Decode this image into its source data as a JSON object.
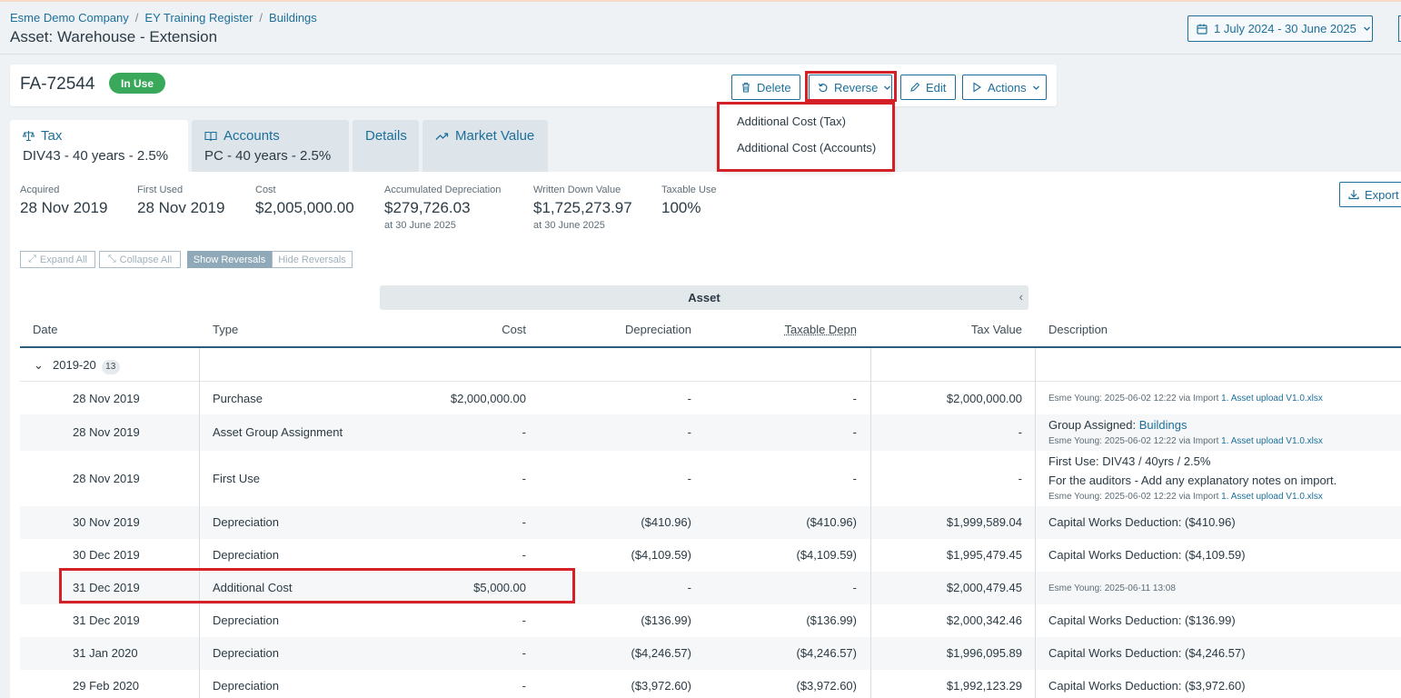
{
  "breadcrumb": [
    "Esme Demo Company",
    "EY Training Register",
    "Buildings"
  ],
  "page_title": "Asset: Warehouse - Extension",
  "date_range": "1 July 2024 - 30 June 2025",
  "asset": {
    "id": "FA-72544",
    "status": "In Use"
  },
  "toolbar": {
    "delete": "Delete",
    "reverse": "Reverse",
    "edit": "Edit",
    "actions": "Actions"
  },
  "reverse_menu": [
    "Additional Cost (Tax)",
    "Additional Cost (Accounts)"
  ],
  "tabs": [
    {
      "name": "Tax",
      "sub": "DIV43 - 40 years - 2.5%"
    },
    {
      "name": "Accounts",
      "sub": "PC - 40 years - 2.5%"
    },
    {
      "name": "Details",
      "sub": ""
    },
    {
      "name": "Market Value",
      "sub": ""
    }
  ],
  "stats": [
    {
      "label": "Acquired",
      "value": "28 Nov 2019",
      "sub": ""
    },
    {
      "label": "First Used",
      "value": "28 Nov 2019",
      "sub": ""
    },
    {
      "label": "Cost",
      "value": "$2,005,000.00",
      "sub": ""
    },
    {
      "label": "Accumulated Depreciation",
      "value": "$279,726.03",
      "sub": "at 30 June 2025"
    },
    {
      "label": "Written Down Value",
      "value": "$1,725,273.97",
      "sub": "at 30 June 2025"
    },
    {
      "label": "Taxable Use",
      "value": "100%",
      "sub": ""
    }
  ],
  "export_label": "Export",
  "view_buttons": {
    "expand": "Expand All",
    "collapse": "Collapse All",
    "show_rev": "Show Reversals",
    "hide_rev": "Hide Reversals"
  },
  "asset_band": "Asset",
  "columns": [
    "Date",
    "Type",
    "Cost",
    "Depreciation",
    "Taxable Depn",
    "Tax Value",
    "Description"
  ],
  "group": {
    "label": "2019-20",
    "count": "13"
  },
  "rows": [
    {
      "date": "28 Nov 2019",
      "type": "Purchase",
      "cost": "$2,000,000.00",
      "depn": "-",
      "tdepn": "-",
      "taxval": "$2,000,000.00",
      "desc_main": "",
      "desc_note": "",
      "audit": "Esme Young: 2025-06-02 12:22 via Import ",
      "audit_link": "1. Asset upload V1.0.xlsx"
    },
    {
      "date": "28 Nov 2019",
      "type": "Asset Group Assignment",
      "cost": "-",
      "depn": "-",
      "tdepn": "-",
      "taxval": "-",
      "desc_main": "Group Assigned: ",
      "desc_link": "Buildings",
      "desc_note": "",
      "audit": "Esme Young: 2025-06-02 12:22 via Import ",
      "audit_link": "1. Asset upload V1.0.xlsx"
    },
    {
      "date": "28 Nov 2019",
      "type": "First Use",
      "cost": "-",
      "depn": "-",
      "tdepn": "-",
      "taxval": "-",
      "desc_main": "First Use: DIV43 / 40yrs / 2.5%",
      "desc_note": "For the auditors - Add any explanatory notes on import.",
      "audit": "Esme Young: 2025-06-02 12:22 via Import ",
      "audit_link": "1. Asset upload V1.0.xlsx"
    },
    {
      "date": "30 Nov 2019",
      "type": "Depreciation",
      "cost": "-",
      "depn": "($410.96)",
      "tdepn": "($410.96)",
      "taxval": "$1,999,589.04",
      "desc_main": "Capital Works Deduction: ($410.96)"
    },
    {
      "date": "30 Dec 2019",
      "type": "Depreciation",
      "cost": "-",
      "depn": "($4,109.59)",
      "tdepn": "($4,109.59)",
      "taxval": "$1,995,479.45",
      "desc_main": "Capital Works Deduction: ($4,109.59)"
    },
    {
      "date": "31 Dec 2019",
      "type": "Additional Cost",
      "cost": "$5,000.00",
      "depn": "-",
      "tdepn": "-",
      "taxval": "$2,000,479.45",
      "desc_main": "",
      "audit": "Esme Young: 2025-06-11 13:08"
    },
    {
      "date": "31 Dec 2019",
      "type": "Depreciation",
      "cost": "-",
      "depn": "($136.99)",
      "tdepn": "($136.99)",
      "taxval": "$2,000,342.46",
      "desc_main": "Capital Works Deduction: ($136.99)"
    },
    {
      "date": "31 Jan 2020",
      "type": "Depreciation",
      "cost": "-",
      "depn": "($4,246.57)",
      "tdepn": "($4,246.57)",
      "taxval": "$1,996,095.89",
      "desc_main": "Capital Works Deduction: ($4,246.57)"
    },
    {
      "date": "29 Feb 2020",
      "type": "Depreciation",
      "cost": "-",
      "depn": "($3,972.60)",
      "tdepn": "($3,972.60)",
      "taxval": "$1,992,123.29",
      "desc_main": "Capital Works Deduction: ($3,972.60)"
    }
  ],
  "colors": {
    "accent": "#1d6f9a",
    "highlight": "#d42027",
    "status_green": "#3aa85a"
  }
}
